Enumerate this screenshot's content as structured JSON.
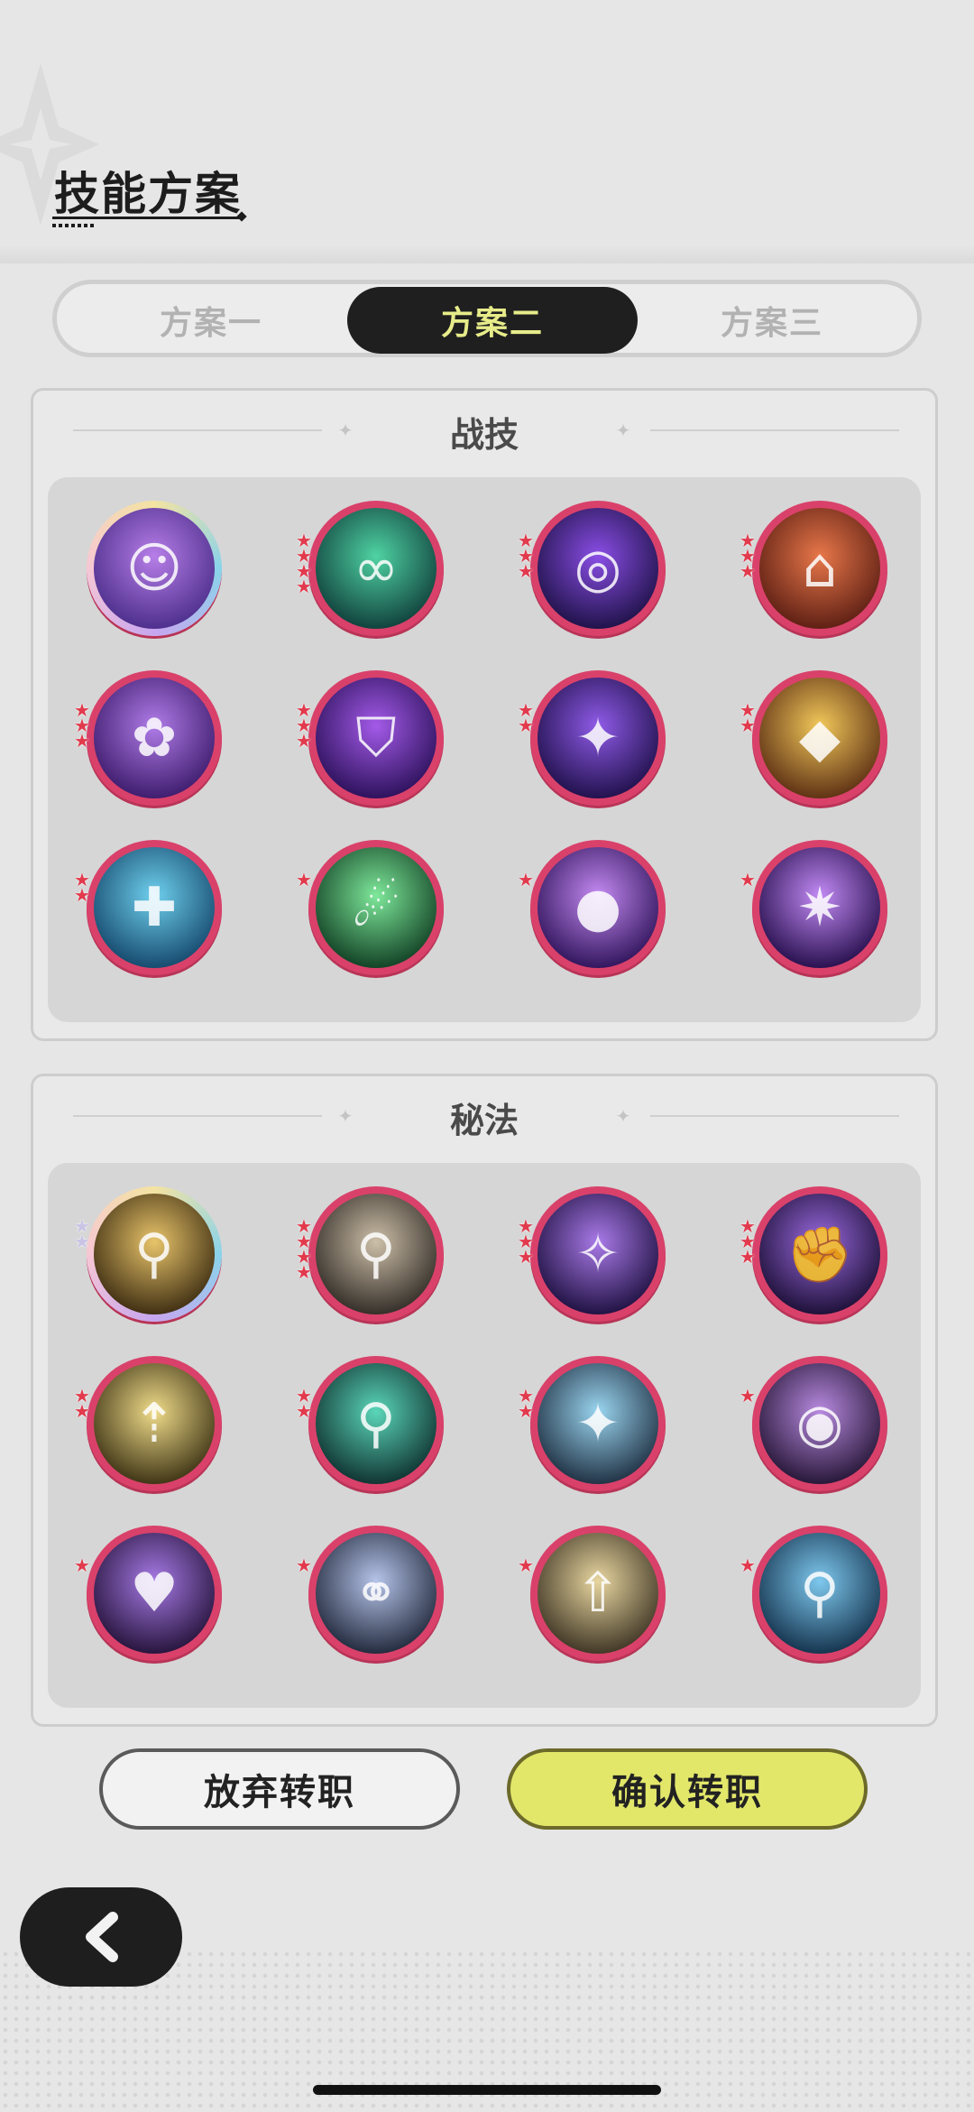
{
  "header": {
    "title": "技能方案"
  },
  "tabs": [
    {
      "label": "方案一",
      "selected": false
    },
    {
      "label": "方案二",
      "selected": true
    },
    {
      "label": "方案三",
      "selected": false
    }
  ],
  "combat": {
    "title": "战技",
    "skills": [
      {
        "icon": "masked-figure-icon",
        "stars": 0,
        "rarity": "gold"
      },
      {
        "icon": "spirit-swirl-icon",
        "stars": 4,
        "rarity": "red"
      },
      {
        "icon": "vortex-icon",
        "stars": 3,
        "rarity": "red"
      },
      {
        "icon": "house-totem-icon",
        "stars": 3,
        "rarity": "red"
      },
      {
        "icon": "flower-spiral-icon",
        "stars": 3,
        "rarity": "red"
      },
      {
        "icon": "crest-shield-icon",
        "stars": 3,
        "rarity": "red"
      },
      {
        "icon": "four-point-star-icon",
        "stars": 2,
        "rarity": "red"
      },
      {
        "icon": "stone-golem-icon",
        "stars": 2,
        "rarity": "red"
      },
      {
        "icon": "cactus-crystal-icon",
        "stars": 2,
        "rarity": "red"
      },
      {
        "icon": "green-comet-icon",
        "stars": 1,
        "rarity": "red"
      },
      {
        "icon": "purple-orb-icon",
        "stars": 1,
        "rarity": "red"
      },
      {
        "icon": "crystal-burst-icon",
        "stars": 1,
        "rarity": "red"
      }
    ]
  },
  "arcane": {
    "title": "秘法",
    "skills": [
      {
        "icon": "praying-figure-icon",
        "stars": 2,
        "rarity": "gold"
      },
      {
        "icon": "flexing-figure-icon",
        "stars": 4,
        "rarity": "red"
      },
      {
        "icon": "glowing-orb-icon",
        "stars": 3,
        "rarity": "red"
      },
      {
        "icon": "muscle-arm-icon",
        "stars": 3,
        "rarity": "red"
      },
      {
        "icon": "light-burst-icon",
        "stars": 2,
        "rarity": "red"
      },
      {
        "icon": "heal-figure-icon",
        "stars": 2,
        "rarity": "red"
      },
      {
        "icon": "sparkle-star-icon",
        "stars": 2,
        "rarity": "red"
      },
      {
        "icon": "eye-figure-icon",
        "stars": 1,
        "rarity": "red"
      },
      {
        "icon": "heart-figure-icon",
        "stars": 1,
        "rarity": "red"
      },
      {
        "icon": "twin-orbs-icon",
        "stars": 1,
        "rarity": "red"
      },
      {
        "icon": "arrow-up-figure-icon",
        "stars": 1,
        "rarity": "red"
      },
      {
        "icon": "water-vortex-figure-icon",
        "stars": 1,
        "rarity": "red"
      }
    ]
  },
  "buttons": {
    "cancel": "放弃转职",
    "confirm": "确认转职"
  },
  "colors": {
    "accent_tab_text": "#e7ec8a",
    "ring_red": "#d9416a",
    "confirm_yellow": "#e2e76a"
  }
}
